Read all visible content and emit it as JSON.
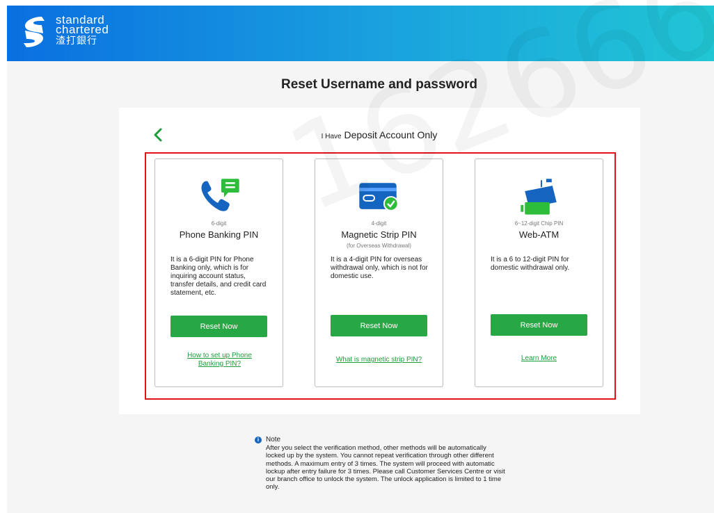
{
  "header": {
    "brand_line1": "standard",
    "brand_line2": "chartered",
    "brand_line3": "渣打銀行"
  },
  "page_title": "Reset Username and password",
  "section": {
    "prefix": "I Have",
    "title": "Deposit Account Only"
  },
  "cards": [
    {
      "sub": "6-digit",
      "name": "Phone Banking PIN",
      "note": "",
      "desc": "It is a 6-digit PIN for Phone Banking only, which is for inquiring account status, transfer details, and credit card statement, etc.",
      "button": "Reset Now",
      "link": "How to set up Phone Banking PIN?"
    },
    {
      "sub": "4-digit",
      "name": "Magnetic Strip PIN",
      "note": "(for Overseas Withdrawal)",
      "desc": "It is a 4-digit PIN for overseas withdrawal only, which is not for domestic use.",
      "button": "Reset Now",
      "link": "What is magnetic strip PIN?"
    },
    {
      "sub": "6~12-digit Chip PIN",
      "name": "Web-ATM",
      "note": "",
      "desc": "It is a 6 to 12-digit PIN for domestic withdrawal only.",
      "button": "Reset Now",
      "link": "Learn More"
    }
  ],
  "note": {
    "title": "Note",
    "text": "After you select the verification method, other methods will be automatically locked up by the system. You cannot repeat verification through other different methods. A maximum entry of 3 times. The system will proceed with automatic lockup after entry failure for 3 times. Please call Customer Services Centre or visit our branch office to unlock the system. The unlock application is limited to 1 time only."
  },
  "watermark": "162666",
  "colors": {
    "header_start": "#0a6fe0",
    "header_end": "#21c6d4",
    "button": "#28a745",
    "link": "#1e9c3a",
    "highlight": "#e1121a",
    "icon_blue": "#1565c0",
    "icon_green": "#2ebd3a"
  },
  "icons": {
    "back": "chevron-left-icon",
    "card1": "phone-chat-icon",
    "card2": "card-check-icon",
    "card3": "chip-card-icon",
    "note": "info-icon"
  }
}
